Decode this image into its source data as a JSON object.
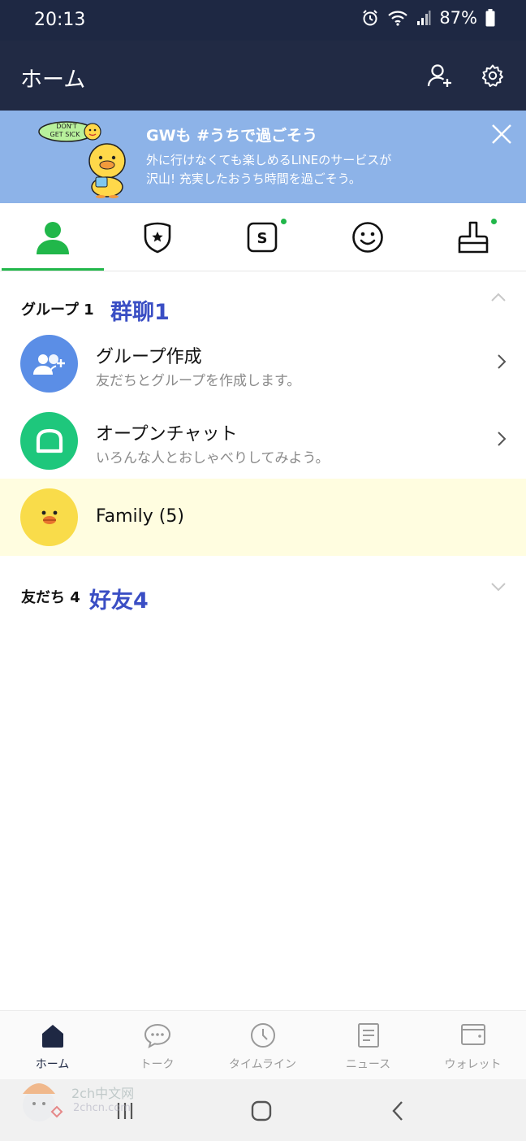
{
  "status_bar": {
    "time": "20:13",
    "battery": "87%",
    "icons": [
      "alarm-icon",
      "wifi-icon",
      "signal-icon",
      "battery-icon"
    ]
  },
  "app_bar": {
    "title": "ホーム",
    "icons": [
      "add-friend-icon",
      "settings-icon"
    ]
  },
  "banner": {
    "sticker_text": "DON'T GET SICK",
    "title": "GWも #うちで過ごそう",
    "line1": "外に行けなくても楽しめるLINEのサービスが",
    "line2": "沢山! 充実したおうち時間を過ごそう。"
  },
  "tabs": [
    {
      "icon": "person-icon",
      "active": true,
      "has_dot": false
    },
    {
      "icon": "shield-star-icon",
      "active": false,
      "has_dot": false
    },
    {
      "icon": "s-coin-icon",
      "active": false,
      "has_dot": true
    },
    {
      "icon": "smiley-icon",
      "active": false,
      "has_dot": false
    },
    {
      "icon": "paint-brush-icon",
      "active": false,
      "has_dot": true
    }
  ],
  "groups_section": {
    "label": "グループ 1",
    "annotation": "群聊1"
  },
  "rows": [
    {
      "name": "グループ作成",
      "subtitle": "友だちとグループを作成します。",
      "icon": "group-add-icon"
    },
    {
      "name": "オープンチャット",
      "subtitle": "いろんな人とおしゃべりしてみよう。",
      "icon": "open-chat-icon"
    },
    {
      "name": "Family (5)",
      "icon": "duck-avatar-icon"
    }
  ],
  "friends_section": {
    "label": "友だち 4",
    "annotation": "好友4"
  },
  "bottom_nav": [
    {
      "label": "ホーム",
      "icon": "home-icon",
      "active": true
    },
    {
      "label": "トーク",
      "icon": "chat-bubble-icon",
      "active": false
    },
    {
      "label": "タイムライン",
      "icon": "clock-icon",
      "active": false
    },
    {
      "label": "ニュース",
      "icon": "news-icon",
      "active": false
    },
    {
      "label": "ウォレット",
      "icon": "wallet-icon",
      "active": false
    }
  ],
  "watermark": {
    "line1": "2ch中文网",
    "line2": "2chcn.com"
  },
  "colors": {
    "header_bg": "#212a44",
    "banner_bg": "#8db3e8",
    "accent_green": "#21b74a",
    "annotation_blue": "#3a4ec4",
    "highlight_row": "#fffde0",
    "group_avatar": "#5b8ee6",
    "openchat_avatar": "#1ec77c",
    "family_avatar": "#f9dc4a"
  }
}
